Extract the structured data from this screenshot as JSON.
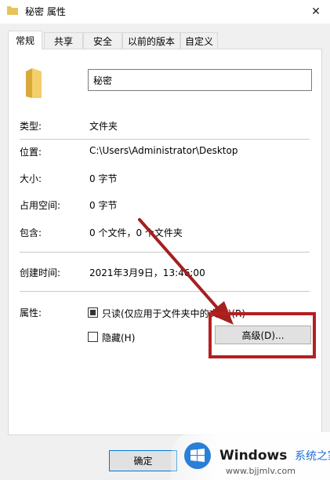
{
  "window": {
    "title": "秘密 属性",
    "close_glyph": "✕"
  },
  "tabs": [
    {
      "label": "常规",
      "active": true
    },
    {
      "label": "共享",
      "active": false
    },
    {
      "label": "安全",
      "active": false
    },
    {
      "label": "以前的版本",
      "active": false
    },
    {
      "label": "自定义",
      "active": false
    }
  ],
  "general": {
    "name_value": "秘密",
    "type_label": "类型:",
    "type_value": "文件夹",
    "location_label": "位置:",
    "location_value": "C:\\Users\\Administrator\\Desktop",
    "size_label": "大小:",
    "size_value": "0 字节",
    "size_on_disk_label": "占用空间:",
    "size_on_disk_value": "0 字节",
    "contains_label": "包含:",
    "contains_value": "0 个文件，0 个文件夹",
    "created_label": "创建时间:",
    "created_value": "2021年3月9日，13:46:00",
    "attributes_label": "属性:",
    "readonly_label": "只读(仅应用于文件夹中的文件)(R)",
    "readonly_checked": true,
    "hidden_label": "隐藏(H)",
    "hidden_checked": false,
    "advanced_label": "高级(D)..."
  },
  "footer": {
    "ok_label": "确定"
  },
  "watermark": {
    "title": "Windows",
    "subtitle": "系统之家",
    "url": "www.bjjmlv.com"
  },
  "colors": {
    "highlight": "#b42020",
    "folder": "#e8c35a",
    "focus_border": "#0078d7"
  },
  "icons": {
    "title": "folder-icon",
    "main": "folder-icon",
    "close": "close-icon",
    "watermark": "windows-logo-icon"
  }
}
